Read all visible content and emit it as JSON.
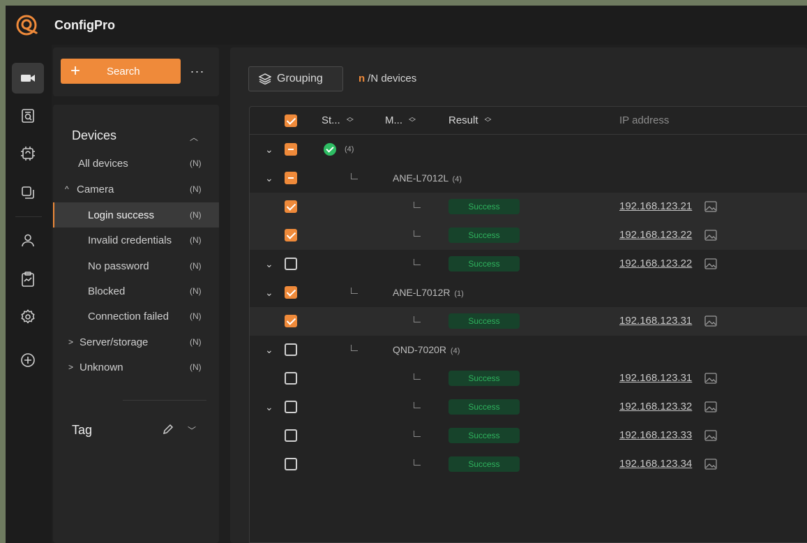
{
  "app": {
    "title": "ConfigPro"
  },
  "colors": {
    "accent": "#ef8a3a",
    "success": "#2fb35e",
    "background": "#1f1f1f"
  },
  "rail": {
    "icons": [
      "camera-icon",
      "inspect-icon",
      "chip-icon",
      "copy-icon",
      "user-icon",
      "clipboard-icon",
      "settings-icon",
      "add-circle-icon"
    ]
  },
  "sidebar": {
    "search_label": "Search",
    "more_label": "···",
    "devices_heading": "Devices",
    "items": [
      {
        "label": "All devices",
        "count": "(N)"
      },
      {
        "label": "Camera",
        "count": "(N)"
      },
      {
        "label": "Login success",
        "count": "(N)"
      },
      {
        "label": "Invalid credentials",
        "count": "(N)"
      },
      {
        "label": "No password",
        "count": "(N)"
      },
      {
        "label": "Blocked",
        "count": "(N)"
      },
      {
        "label": "Connection failed",
        "count": "(N)"
      },
      {
        "label": "Server/storage",
        "count": "(N)"
      },
      {
        "label": "Unknown",
        "count": "(N)"
      }
    ],
    "tag_heading": "Tag"
  },
  "main": {
    "grouping_label": "Grouping",
    "count_n": "n",
    "count_text": "/N devices",
    "columns": [
      "St...",
      "M...",
      "Result",
      "IP address"
    ],
    "status_group_count": "(4)",
    "models": [
      {
        "name": "ANE-L7012L",
        "count": "(4)"
      },
      {
        "name": "ANE-L7012R",
        "count": "(1)"
      },
      {
        "name": "QND-7020R",
        "count": "(4)"
      }
    ],
    "rows": [
      {
        "result": "Success",
        "ip": "192.168.123.21"
      },
      {
        "result": "Success",
        "ip": "192.168.123.22"
      },
      {
        "result": "Success",
        "ip": "192.168.123.22"
      },
      {
        "result": "Success",
        "ip": "192.168.123.31"
      },
      {
        "result": "Success",
        "ip": "192.168.123.31"
      },
      {
        "result": "Success",
        "ip": "192.168.123.32"
      },
      {
        "result": "Success",
        "ip": "192.168.123.33"
      },
      {
        "result": "Success",
        "ip": "192.168.123.34"
      }
    ]
  }
}
